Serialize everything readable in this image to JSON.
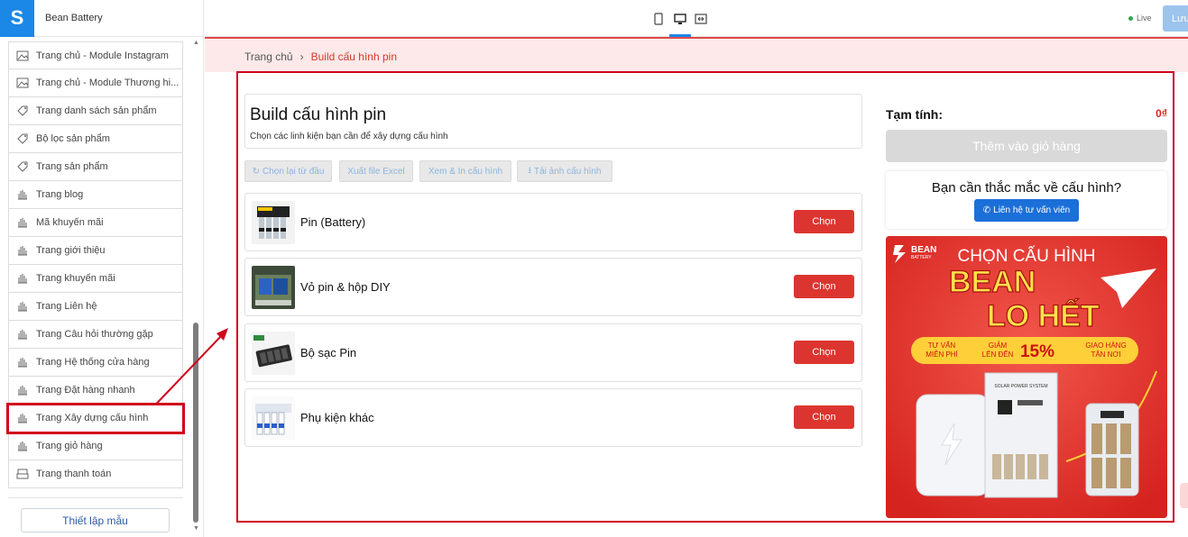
{
  "app": {
    "name": "Bean Battery",
    "logo_letter": "S"
  },
  "sidebar": {
    "items": [
      {
        "label": "Trang chủ - Module Instagram",
        "icon": "image-icon"
      },
      {
        "label": "Trang chủ - Module Thương hi...",
        "icon": "image-icon"
      },
      {
        "label": "Trang danh sách sản phẩm",
        "icon": "tag-icon"
      },
      {
        "label": "Bộ lọc sản phẩm",
        "icon": "tag-icon"
      },
      {
        "label": "Trang sản phẩm",
        "icon": "tag-icon"
      },
      {
        "label": "Trang blog",
        "icon": "hand-icon"
      },
      {
        "label": "Mã khuyến mãi",
        "icon": "hand-icon"
      },
      {
        "label": "Trang giới thiệu",
        "icon": "hand-icon"
      },
      {
        "label": "Trang khuyến mãi",
        "icon": "hand-icon"
      },
      {
        "label": "Trang Liên hệ",
        "icon": "hand-icon"
      },
      {
        "label": "Trang Câu hỏi thường gặp",
        "icon": "hand-icon"
      },
      {
        "label": "Trang Hệ thống cửa hàng",
        "icon": "hand-icon"
      },
      {
        "label": "Trang Đặt hàng nhanh",
        "icon": "hand-icon"
      },
      {
        "label": "Trang Xây dựng cấu hình",
        "icon": "hand-icon",
        "active": true
      },
      {
        "label": "Trang giỏ hàng",
        "icon": "hand-icon"
      },
      {
        "label": "Trang thanh toán",
        "icon": "cart-icon"
      }
    ],
    "setup_button": "Thiết lập mẫu"
  },
  "topbar": {
    "devices": [
      "mobile-icon",
      "desktop-icon",
      "fullwidth-icon"
    ],
    "active_device": "desktop",
    "live_label": "Live",
    "save_label": "Lưu"
  },
  "breadcrumb": {
    "home": "Trang chủ",
    "separator": "›",
    "current": "Build cấu hình pin"
  },
  "builder": {
    "title": "Build cấu hình pin",
    "subtitle": "Chọn các linh kiện bạn cần để xây dựng cấu hình",
    "toolbar": [
      {
        "label": "Chọn lại từ đầu",
        "icon": "refresh-icon"
      },
      {
        "label": "Xuất file Excel",
        "icon": ""
      },
      {
        "label": "Xem & In cấu hình",
        "icon": ""
      },
      {
        "label": "Tải ảnh cấu hình",
        "icon": "download-icon"
      }
    ],
    "components": [
      {
        "name": "Pin (Battery)",
        "button": "Chọn"
      },
      {
        "name": "Vỏ pin & hộp DIY",
        "button": "Chọn"
      },
      {
        "name": "Bộ sạc Pin",
        "button": "Chọn"
      },
      {
        "name": "Phụ kiện khác",
        "button": "Chọn"
      }
    ]
  },
  "summary": {
    "label": "Tạm tính:",
    "value": "0₫",
    "add_to_cart": "Thêm vào giỏ hàng",
    "help_question": "Bạn cần thắc mắc về cấu hình?",
    "help_button": "Liên hệ tư vấn viên"
  },
  "banner": {
    "brand_line1": "BEAN",
    "brand_line2": "BATTERY",
    "headline": "CHỌN CẤU HÌNH",
    "big1": "BEAN",
    "big2": "LO HẾT",
    "perk1_a": "TƯ VẤN",
    "perk1_b": "MIỄN PHÍ",
    "perk2_a": "GIẢM",
    "perk2_b": "LÊN ĐẾN",
    "perk2_pct": "15%",
    "perk3_a": "GIAO HÀNG",
    "perk3_b": "TẬN NƠI",
    "cabinet_label": "SOLAR POWER SYSTEM"
  },
  "colors": {
    "accent": "#1b87e6",
    "brand_red": "#dc3530",
    "highlight": "#d0021b"
  }
}
